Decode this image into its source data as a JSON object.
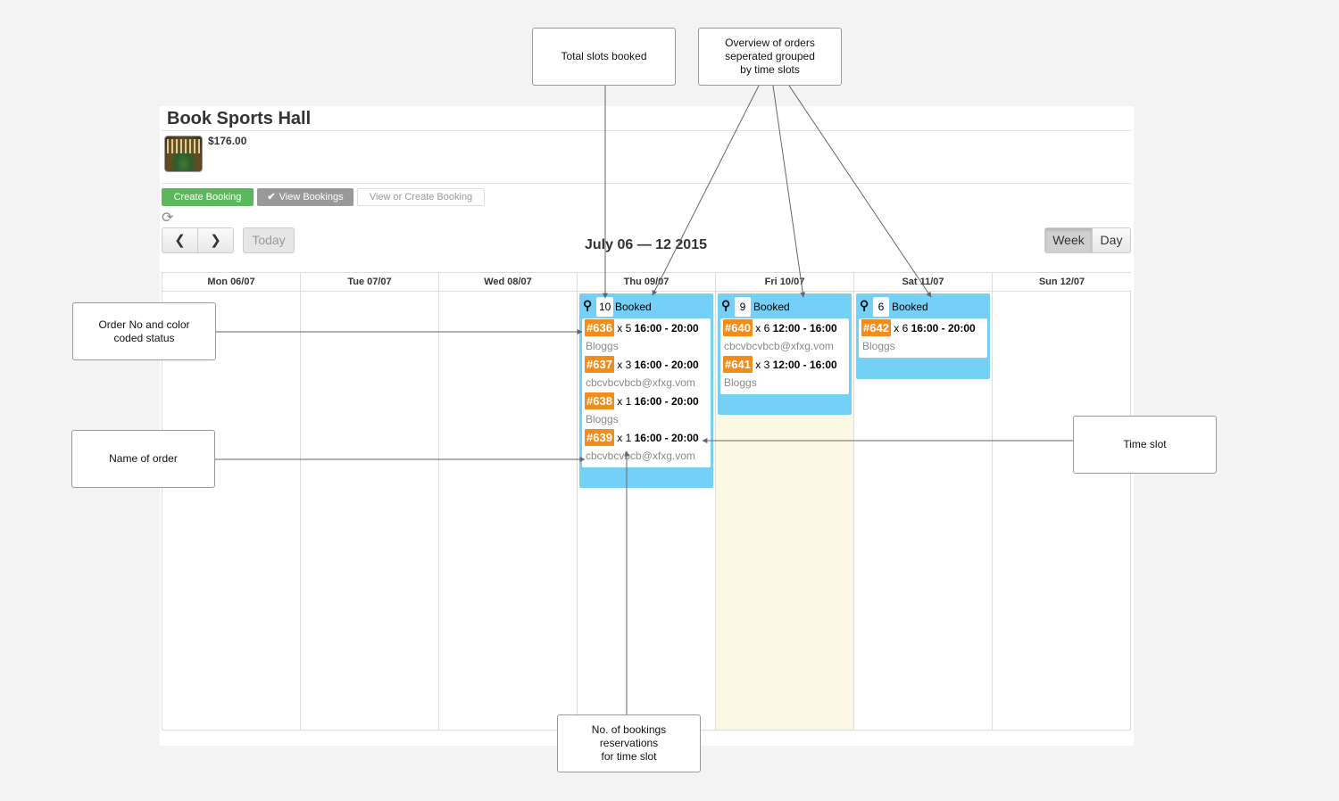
{
  "page": {
    "title": "Book Sports Hall",
    "price": "$176.00"
  },
  "actions": {
    "create_booking": "Create Booking",
    "view_bookings": "View Bookings",
    "view_or_create": "View or Create Booking"
  },
  "toolbar": {
    "prev": "‹",
    "next": "›",
    "today": "Today",
    "range": "July 06 — 12 2015",
    "week": "Week",
    "day": "Day"
  },
  "days": [
    "Mon 06/07",
    "Tue 07/07",
    "Wed 08/07",
    "Thu 09/07",
    "Fri 10/07",
    "Sat 11/07",
    "Sun 12/07"
  ],
  "events": {
    "thu": {
      "count": "10",
      "label": "Booked",
      "orders": [
        {
          "no": "#636",
          "qty": "x 5",
          "slot": "16:00 - 20:00",
          "name": "Bloggs"
        },
        {
          "no": "#637",
          "qty": "x 3",
          "slot": "16:00 - 20:00",
          "name": "cbcvbcvbcb@xfxg.vom"
        },
        {
          "no": "#638",
          "qty": "x 1",
          "slot": "16:00 - 20:00",
          "name": "Bloggs"
        },
        {
          "no": "#639",
          "qty": "x 1",
          "slot": "16:00 - 20:00",
          "name": "cbcvbcvbcb@xfxg.vom"
        }
      ]
    },
    "fri": {
      "count": "9",
      "label": "Booked",
      "orders": [
        {
          "no": "#640",
          "qty": "x 6",
          "slot": "12:00 - 16:00",
          "name": "cbcvbcvbcb@xfxg.vom"
        },
        {
          "no": "#641",
          "qty": "x 3",
          "slot": "12:00 - 16:00",
          "name": "Bloggs"
        }
      ]
    },
    "sat": {
      "count": "6",
      "label": "Booked",
      "orders": [
        {
          "no": "#642",
          "qty": "x 6",
          "slot": "16:00 - 20:00",
          "name": "Bloggs"
        }
      ]
    }
  },
  "callouts": {
    "total_slots": "Total slots booked",
    "overview_1": "Overview of orders",
    "overview_2": "seperated grouped",
    "overview_3": "by time slots",
    "order_no_1": "Order No and color",
    "order_no_2": "coded status",
    "name_of_order": "Name of order",
    "time_slot": "Time slot",
    "bookings_1": "No. of bookings",
    "bookings_2": "reservations",
    "bookings_3": "for time slot"
  },
  "colors": {
    "event_bg": "#75d0f7",
    "order_badge": "#f28c1c",
    "create_btn": "#5cb85c",
    "today_highlight": "#fcf8e3"
  }
}
